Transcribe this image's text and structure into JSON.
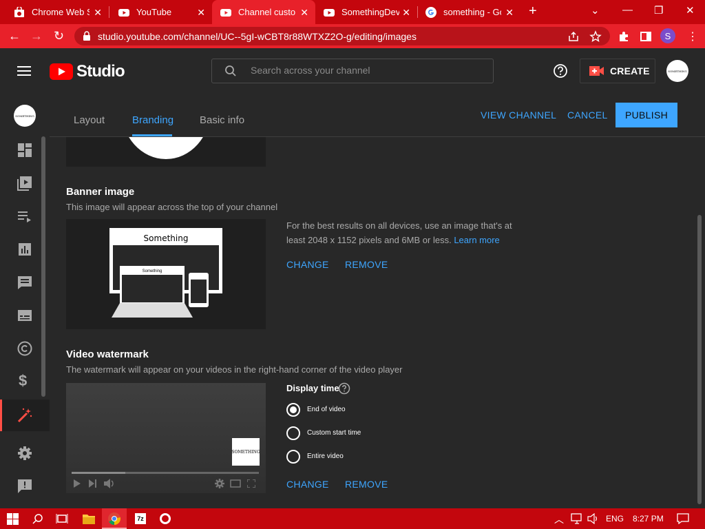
{
  "browser": {
    "tabs": [
      {
        "title": "Chrome Web Store",
        "icon": "chrome-web-store-icon"
      },
      {
        "title": "YouTube",
        "icon": "youtube-icon"
      },
      {
        "title": "Channel customization",
        "icon": "youtube-icon",
        "active": true
      },
      {
        "title": "SomethingDev",
        "icon": "youtube-icon"
      },
      {
        "title": "something - Google Search",
        "icon": "google-icon"
      }
    ],
    "url": "studio.youtube.com/channel/UC--5gI-wCBT8r88WTXZ2O-g/editing/images",
    "profile_initial": "S"
  },
  "header": {
    "logo_text": "Studio",
    "search_placeholder": "Search across your channel",
    "create_label": "CREATE",
    "avatar_text": "SOMETHING"
  },
  "tabs": {
    "layout": "Layout",
    "branding": "Branding",
    "basic_info": "Basic info"
  },
  "actions": {
    "view_channel": "VIEW CHANNEL",
    "cancel": "CANCEL",
    "publish": "PUBLISH"
  },
  "banner": {
    "title": "Banner image",
    "description": "This image will appear across the top of your channel",
    "preview_text_desktop": "Something",
    "preview_text_laptop": "Something",
    "info": "For the best results on all devices, use an image that's at least 2048 x 1152 pixels and 6MB or less.",
    "learn_more": "Learn more",
    "change": "CHANGE",
    "remove": "REMOVE"
  },
  "watermark": {
    "title": "Video watermark",
    "description": "The watermark will appear on your videos in the right-hand corner of the video player",
    "watermark_text": "SOMETHING",
    "display_time_label": "Display time",
    "options": [
      "End of video",
      "Custom start time",
      "Entire video"
    ],
    "selected_option": "End of video",
    "change": "CHANGE",
    "remove": "REMOVE"
  },
  "taskbar": {
    "language": "ENG",
    "time": "8:27 PM"
  },
  "colors": {
    "accent": "#3ea6ff",
    "youtube_red": "#ff0000",
    "chrome_frame": "#c4060d",
    "background": "#282828"
  }
}
